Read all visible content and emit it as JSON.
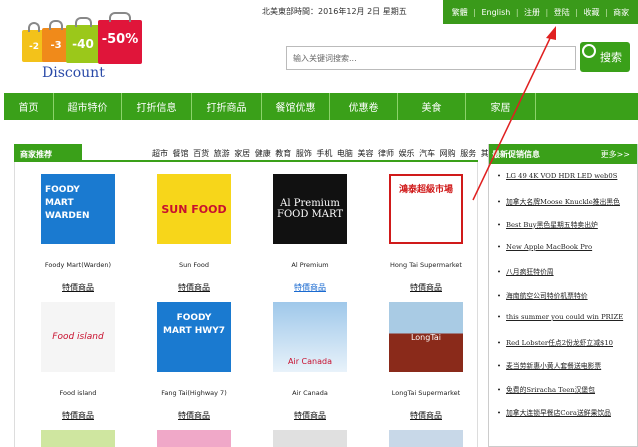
{
  "logo": {
    "discount_text": "Discount",
    "tags": [
      "-2",
      "-3",
      "-40",
      "-50%"
    ]
  },
  "header": {
    "date_text": "北美東部時間：2016年12月  2日    星期五"
  },
  "topnav": {
    "items": [
      "繁體",
      "English",
      "注册",
      "登陆",
      "收藏",
      "商家"
    ]
  },
  "search": {
    "placeholder": "输入关键词搜索...",
    "button_label": "搜索"
  },
  "mainnav": {
    "items": [
      "首页",
      "超市特价",
      "打折信息",
      "打折商品",
      "餐馆优惠",
      "优惠卷",
      "美食",
      "家居"
    ]
  },
  "merchants": {
    "title": "商家推荐",
    "categories": [
      "超市",
      "餐馆",
      "百货",
      "旅游",
      "家居",
      "健康",
      "教育",
      "服饰",
      "手机",
      "电脑",
      "美容",
      "律师",
      "娱乐",
      "汽车",
      "网购",
      "服务",
      "其他"
    ],
    "stores": [
      {
        "name": "Foody Mart(Warden)",
        "link": "特價商品",
        "img": "FOODY MART WARDEN"
      },
      {
        "name": "Sun Food",
        "link": "特價商品",
        "img": "SUN FOOD"
      },
      {
        "name": "Al Premium",
        "link": "特價商品",
        "img": "Al Premium FOOD MART"
      },
      {
        "name": "Hong Tai Supermarket",
        "link": "特價商品",
        "img": "鴻泰超級市場"
      },
      {
        "name": "Food island",
        "link": "特價商品",
        "img": "Food island"
      },
      {
        "name": "Fang Tai(Highway 7)",
        "link": "特價商品",
        "img": "FOODY MART HWY7"
      },
      {
        "name": "Air Canada",
        "link": "特價商品",
        "img": "Air Canada"
      },
      {
        "name": "LongTai Supermarket",
        "link": "特價商品",
        "img": "LongTai"
      }
    ]
  },
  "sidebar": {
    "title": "最新促销信息",
    "more": "更多>>",
    "items": [
      "LG 49 4K VOD HDR LED web0S",
      "加拿大名牌Moose Knuckle推出黑色",
      "Best Buy黑色星期五特卖出炉",
      "New Apple MacBook Pro",
      "八月疯狂特价周",
      "海南航空公司特价机票特价",
      "this summer you could win PRIZE",
      "Red Lobster任点2份龙虾立减$10",
      "麦当劳新惠小黄人套餐送电影票",
      "免费的Sriracha Teen汉堡包",
      "加拿大连锁早餐店Cora送鲜果饮品"
    ]
  },
  "colors": {
    "green": "#3aa019",
    "dark_green": "#2a8a10",
    "arrow_red": "#e02020"
  }
}
